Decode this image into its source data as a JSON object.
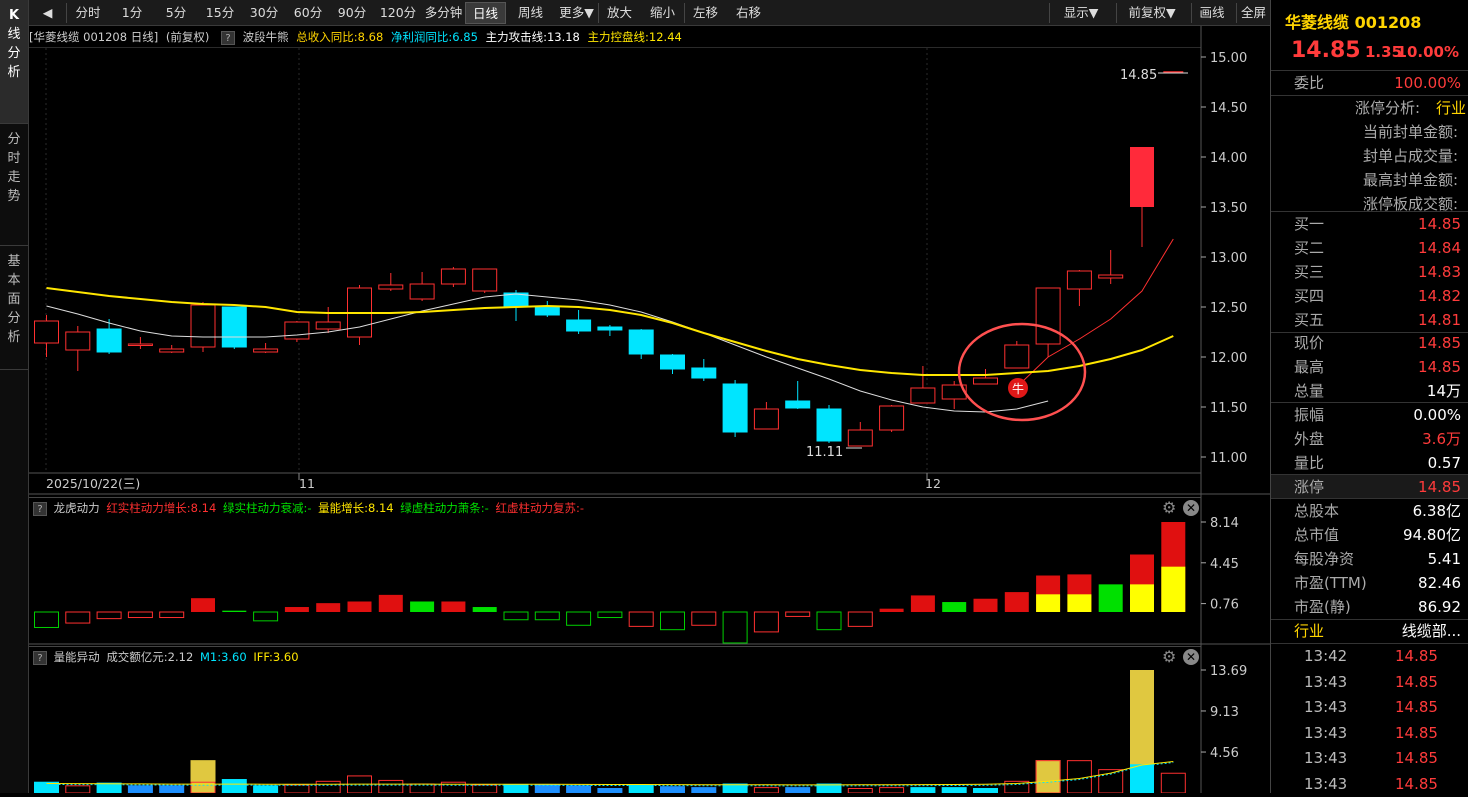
{
  "left_tabs": [
    "K线分析",
    "分时走势",
    "基本面分析"
  ],
  "toolbar": {
    "back": "◀",
    "items": [
      "分时",
      "1分",
      "5分",
      "15分",
      "30分",
      "60分",
      "90分",
      "120分",
      "多分钟",
      "日线",
      "周线",
      "更多▼",
      "放大",
      "缩小",
      "左移",
      "右移"
    ],
    "active": "日线",
    "right_items": [
      "显示▼",
      "前复权▼",
      "画线",
      "全屏"
    ]
  },
  "info": {
    "title": "[华菱线缆 001208 日线]",
    "adj": "(前复权)",
    "help": "?",
    "ind_name": "波段牛熊",
    "rev": "总收入同比:8.68",
    "profit": "净利润同比:6.85",
    "attack": "主力攻击线:13.18",
    "control": "主力控盘线:12.44"
  },
  "main_chart": {
    "y_ticks": [
      "15.00",
      "14.50",
      "14.00",
      "13.50",
      "13.00",
      "12.50",
      "12.00",
      "11.50",
      "11.00"
    ],
    "x_labels": [
      "2025/10/22(三)",
      "11",
      "12"
    ],
    "low_label": "11.11",
    "high_label": "14.85",
    "signal": "牛"
  },
  "sub1": {
    "name": "龙虎动力",
    "f1": "红实柱动力增长:8.14",
    "f2": "绿实柱动力衰减:-",
    "f3": "量能增长:8.14",
    "f4": "绿虚柱动力萧条:-",
    "f5": "红虚柱动力复苏:-",
    "y_ticks": [
      "8.14",
      "4.45",
      "0.76"
    ]
  },
  "sub2": {
    "name": "量能异动",
    "f1": "成交额亿元:2.12",
    "f2": "M1:3.60",
    "f3": "IFF:3.60",
    "y_ticks": [
      "13.69",
      "9.13",
      "4.56"
    ]
  },
  "chart_data": [
    {
      "type": "candlestick",
      "title": "华菱线缆 001208 日线",
      "candles": [
        {
          "o": 12.14,
          "h": 12.42,
          "l": 12.0,
          "c": 12.36
        },
        {
          "o": 12.07,
          "h": 12.31,
          "l": 11.86,
          "c": 12.25
        },
        {
          "o": 12.28,
          "h": 12.38,
          "l": 12.03,
          "c": 12.05
        },
        {
          "o": 12.12,
          "h": 12.2,
          "l": 12.08,
          "c": 12.13
        },
        {
          "o": 12.05,
          "h": 12.12,
          "l": 12.04,
          "c": 12.08
        },
        {
          "o": 12.1,
          "h": 12.55,
          "l": 12.05,
          "c": 12.52
        },
        {
          "o": 12.5,
          "h": 12.5,
          "l": 12.08,
          "c": 12.1
        },
        {
          "o": 12.05,
          "h": 12.14,
          "l": 12.04,
          "c": 12.08
        },
        {
          "o": 12.18,
          "h": 12.36,
          "l": 12.15,
          "c": 12.35
        },
        {
          "o": 12.28,
          "h": 12.5,
          "l": 12.24,
          "c": 12.35
        },
        {
          "o": 12.2,
          "h": 12.72,
          "l": 12.12,
          "c": 12.69
        },
        {
          "o": 12.68,
          "h": 12.84,
          "l": 12.66,
          "c": 12.72
        },
        {
          "o": 12.58,
          "h": 12.85,
          "l": 12.56,
          "c": 12.73
        },
        {
          "o": 12.73,
          "h": 12.9,
          "l": 12.7,
          "c": 12.88
        },
        {
          "o": 12.66,
          "h": 12.88,
          "l": 12.64,
          "c": 12.88
        },
        {
          "o": 12.64,
          "h": 12.67,
          "l": 12.36,
          "c": 12.5
        },
        {
          "o": 12.5,
          "h": 12.56,
          "l": 12.4,
          "c": 12.42
        },
        {
          "o": 12.37,
          "h": 12.47,
          "l": 12.23,
          "c": 12.26
        },
        {
          "o": 12.3,
          "h": 12.32,
          "l": 12.21,
          "c": 12.27
        },
        {
          "o": 12.27,
          "h": 12.28,
          "l": 11.98,
          "c": 12.03
        },
        {
          "o": 12.02,
          "h": 12.03,
          "l": 11.83,
          "c": 11.88
        },
        {
          "o": 11.89,
          "h": 11.98,
          "l": 11.76,
          "c": 11.79
        },
        {
          "o": 11.73,
          "h": 11.77,
          "l": 11.2,
          "c": 11.25
        },
        {
          "o": 11.28,
          "h": 11.55,
          "l": 11.28,
          "c": 11.48
        },
        {
          "o": 11.56,
          "h": 11.76,
          "l": 11.48,
          "c": 11.49
        },
        {
          "o": 11.48,
          "h": 11.52,
          "l": 11.14,
          "c": 11.16
        },
        {
          "o": 11.11,
          "h": 11.35,
          "l": 11.11,
          "c": 11.27
        },
        {
          "o": 11.27,
          "h": 11.52,
          "l": 11.25,
          "c": 11.51
        },
        {
          "o": 11.54,
          "h": 11.91,
          "l": 11.54,
          "c": 11.69
        },
        {
          "o": 11.58,
          "h": 11.76,
          "l": 11.48,
          "c": 11.72
        },
        {
          "o": 11.73,
          "h": 11.88,
          "l": 11.73,
          "c": 11.79
        },
        {
          "o": 11.89,
          "h": 12.16,
          "l": 11.89,
          "c": 12.12
        },
        {
          "o": 12.13,
          "h": 12.69,
          "l": 12.0,
          "c": 12.69
        },
        {
          "o": 12.68,
          "h": 12.87,
          "l": 12.51,
          "c": 12.86
        },
        {
          "o": 12.79,
          "h": 13.07,
          "l": 12.73,
          "c": 12.82
        },
        {
          "o": 13.5,
          "h": 14.1,
          "l": 13.1,
          "c": 14.1
        },
        {
          "o": 14.85,
          "h": 14.85,
          "l": 14.85,
          "c": 14.85
        }
      ],
      "ma_white": [
        12.51,
        12.43,
        12.34,
        12.26,
        12.21,
        12.2,
        12.2,
        12.2,
        12.22,
        12.25,
        12.3,
        12.38,
        12.46,
        12.53,
        12.6,
        12.63,
        12.6,
        12.57,
        12.52,
        12.45,
        12.35,
        12.24,
        12.12,
        12.0,
        11.89,
        11.78,
        11.66,
        11.57,
        11.5,
        11.46,
        11.45,
        11.48,
        11.56,
        11.76,
        11.98,
        12.15,
        12.3,
        12.45,
        12.65,
        12.92,
        13.18
      ],
      "ma_yellow": [
        12.69,
        12.65,
        12.61,
        12.58,
        12.55,
        12.53,
        12.52,
        12.5,
        12.45,
        12.44,
        12.44,
        12.44,
        12.45,
        12.47,
        12.49,
        12.5,
        12.51,
        12.5,
        12.47,
        12.42,
        12.34,
        12.24,
        12.15,
        12.06,
        11.98,
        11.92,
        11.87,
        11.84,
        11.82,
        11.82,
        11.82,
        11.84,
        11.86,
        11.91,
        11.98,
        12.07,
        12.21,
        12.44
      ],
      "ylim": [
        10.96,
        15.1
      ]
    },
    {
      "type": "bar",
      "title": "龙虎动力",
      "bars": [
        {
          "v": -1.4,
          "c": "green",
          "hollow": true
        },
        {
          "v": -1.0,
          "c": "red",
          "hollow": true
        },
        {
          "v": -0.6,
          "c": "red",
          "hollow": true
        },
        {
          "v": -0.5,
          "c": "red",
          "hollow": true
        },
        {
          "v": -0.5,
          "c": "red",
          "hollow": true
        },
        {
          "v": 1.25,
          "c": "red",
          "hollow": false
        },
        {
          "v": 0.12,
          "c": "green",
          "hollow": false
        },
        {
          "v": -0.8,
          "c": "green",
          "hollow": true
        },
        {
          "v": 0.45,
          "c": "red",
          "hollow": false
        },
        {
          "v": 0.8,
          "c": "red",
          "hollow": false
        },
        {
          "v": 0.95,
          "c": "red",
          "hollow": false
        },
        {
          "v": 1.55,
          "c": "red",
          "hollow": false
        },
        {
          "v": 0.95,
          "c": "green",
          "hollow": false
        },
        {
          "v": 0.95,
          "c": "red",
          "hollow": false
        },
        {
          "v": 0.45,
          "c": "green",
          "hollow": false
        },
        {
          "v": -0.7,
          "c": "green",
          "hollow": true
        },
        {
          "v": -0.7,
          "c": "green",
          "hollow": true
        },
        {
          "v": -1.2,
          "c": "green",
          "hollow": true
        },
        {
          "v": -0.5,
          "c": "green",
          "hollow": true
        },
        {
          "v": -1.3,
          "c": "red",
          "hollow": true
        },
        {
          "v": -1.6,
          "c": "green",
          "hollow": true
        },
        {
          "v": -1.2,
          "c": "red",
          "hollow": true
        },
        {
          "v": -2.8,
          "c": "green",
          "hollow": true
        },
        {
          "v": -1.8,
          "c": "red",
          "hollow": true
        },
        {
          "v": -0.4,
          "c": "red",
          "hollow": true
        },
        {
          "v": -1.6,
          "c": "green",
          "hollow": true
        },
        {
          "v": -1.3,
          "c": "red",
          "hollow": true
        },
        {
          "v": 0.3,
          "c": "red",
          "hollow": false
        },
        {
          "v": 1.5,
          "c": "red",
          "hollow": false
        },
        {
          "v": 0.9,
          "c": "green",
          "hollow": false
        },
        {
          "v": 1.2,
          "c": "red",
          "hollow": false
        },
        {
          "v": 1.8,
          "c": "red",
          "hollow": false
        },
        {
          "v": 3.3,
          "c": "red",
          "hollow": false,
          "y": 1.6
        },
        {
          "v": 3.4,
          "c": "red",
          "hollow": false,
          "y": 1.6
        },
        {
          "v": 2.5,
          "c": "green",
          "hollow": false
        },
        {
          "v": 5.2,
          "c": "red",
          "hollow": false,
          "y": 2.5
        },
        {
          "v": 8.14,
          "c": "red",
          "hollow": false,
          "y": 4.1
        }
      ],
      "ylim": [
        -3,
        9.2
      ]
    },
    {
      "type": "bar",
      "title": "量能异动",
      "vols": [
        {
          "v": 1.2,
          "c": "cyan"
        },
        {
          "v": 0.8,
          "c": "red"
        },
        {
          "v": 1.1,
          "c": "cyan"
        },
        {
          "v": 0.8,
          "c": "blue"
        },
        {
          "v": 0.8,
          "c": "blue"
        },
        {
          "v": 3.6,
          "c": "redy",
          "y": 1.2
        },
        {
          "v": 1.5,
          "c": "cyan"
        },
        {
          "v": 0.8,
          "c": "cyan"
        },
        {
          "v": 0.9,
          "c": "red"
        },
        {
          "v": 1.3,
          "c": "red"
        },
        {
          "v": 1.9,
          "c": "red"
        },
        {
          "v": 1.4,
          "c": "red"
        },
        {
          "v": 1.0,
          "c": "red"
        },
        {
          "v": 1.2,
          "c": "red"
        },
        {
          "v": 0.9,
          "c": "red"
        },
        {
          "v": 0.9,
          "c": "cyan"
        },
        {
          "v": 0.9,
          "c": "blue"
        },
        {
          "v": 0.8,
          "c": "blue"
        },
        {
          "v": 0.5,
          "c": "blue"
        },
        {
          "v": 0.9,
          "c": "cyan"
        },
        {
          "v": 0.7,
          "c": "blue"
        },
        {
          "v": 0.6,
          "c": "blue"
        },
        {
          "v": 1.0,
          "c": "cyan"
        },
        {
          "v": 0.6,
          "c": "red"
        },
        {
          "v": 0.6,
          "c": "blue"
        },
        {
          "v": 1.0,
          "c": "cyan"
        },
        {
          "v": 0.5,
          "c": "red"
        },
        {
          "v": 0.6,
          "c": "red"
        },
        {
          "v": 0.6,
          "c": "cyan"
        },
        {
          "v": 0.6,
          "c": "cyan"
        },
        {
          "v": 0.5,
          "c": "cyan"
        },
        {
          "v": 1.3,
          "c": "red",
          "y": 1.3
        },
        {
          "v": 3.6,
          "c": "redy",
          "y": 3.6
        },
        {
          "v": 3.6,
          "c": "red"
        },
        {
          "v": 2.6,
          "c": "red"
        },
        {
          "v": 13.69,
          "c": "cyany",
          "y": 3.2
        },
        {
          "v": 2.2,
          "c": "red"
        }
      ],
      "m1": [
        0.95,
        0.93,
        0.92,
        0.9,
        0.88,
        0.88,
        0.88,
        0.87,
        0.87,
        0.87,
        0.88,
        0.88,
        0.88,
        0.87,
        0.87,
        0.86,
        0.86,
        0.85,
        0.84,
        0.83,
        0.82,
        0.81,
        0.8,
        0.8,
        0.79,
        0.79,
        0.8,
        0.8,
        0.82,
        0.84,
        0.86,
        0.95,
        1.2,
        1.5,
        2.1,
        3.0,
        3.4,
        3.6
      ],
      "ylim": [
        0,
        14.3
      ]
    }
  ],
  "rpanel": {
    "name": "华菱线缆",
    "code": "001208",
    "price": "14.85",
    "change": "1.35",
    "pct": "10.00%",
    "weibi_lbl": "委比",
    "weibi": "100.00%",
    "zt_title": "涨停分析:",
    "zt_link": "行业",
    "zt_items": [
      "当前封单金额:",
      "封单占成交量:",
      "最高封单金额:",
      "涨停板成交额:"
    ],
    "bids": [
      [
        "买一",
        "14.85"
      ],
      [
        "买二",
        "14.84"
      ],
      [
        "买三",
        "14.83"
      ],
      [
        "买四",
        "14.82"
      ],
      [
        "买五",
        "14.81"
      ]
    ],
    "quote": [
      [
        "现价",
        "14.85",
        "red"
      ],
      [
        "最高",
        "14.85",
        "red"
      ],
      [
        "总量",
        "14万",
        "wht"
      ]
    ],
    "quote2": [
      [
        "振幅",
        "0.00%",
        "wht"
      ],
      [
        "外盘",
        "3.6万",
        "red"
      ],
      [
        "量比",
        "0.57",
        "wht"
      ]
    ],
    "zhangting": [
      "涨停",
      "14.85"
    ],
    "fund": [
      [
        "总股本",
        "6.38亿"
      ],
      [
        "总市值",
        "94.80亿"
      ],
      [
        "每股净资",
        "5.41"
      ],
      [
        "市盈(TTM)",
        "82.46"
      ],
      [
        "市盈(静)",
        "86.92"
      ]
    ],
    "industry": [
      "行业",
      "线缆部..."
    ],
    "ticks": [
      [
        "13:42",
        "14.85"
      ],
      [
        "13:43",
        "14.85"
      ],
      [
        "13:43",
        "14.85"
      ],
      [
        "13:43",
        "14.85"
      ],
      [
        "13:43",
        "14.85"
      ],
      [
        "13:43",
        "14.85"
      ]
    ]
  }
}
